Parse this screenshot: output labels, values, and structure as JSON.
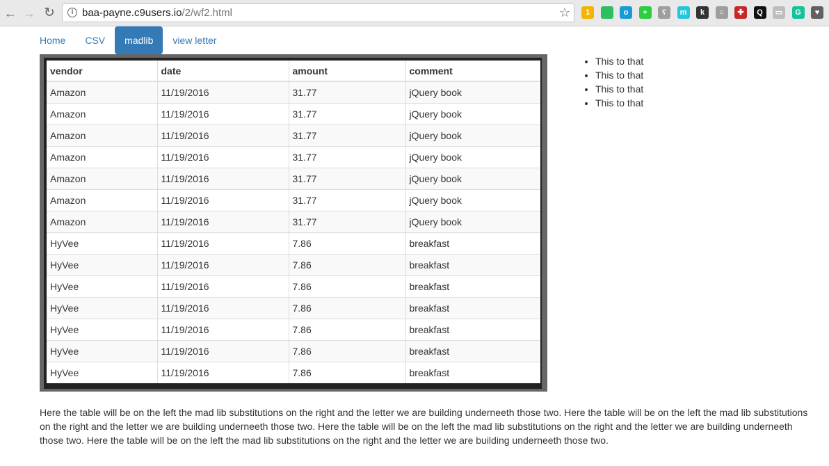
{
  "browser": {
    "url_host": "baa-payne.c9users.io",
    "url_path": "/2/wf2.html",
    "extensions": [
      {
        "name": "sticky-notes-icon",
        "color": "#f4b400",
        "glyph": "1"
      },
      {
        "name": "evernote-icon",
        "color": "#2dbe60",
        "glyph": ""
      },
      {
        "name": "circle-ext-icon",
        "color": "#1a9bd7",
        "glyph": "o"
      },
      {
        "name": "plus-ext-icon",
        "color": "#2ecc40",
        "glyph": "+"
      },
      {
        "name": "bear-ext-icon",
        "color": "#9e9e9e",
        "glyph": "ʕ"
      },
      {
        "name": "m-ext-icon",
        "color": "#26c6da",
        "glyph": "m"
      },
      {
        "name": "k-ext-icon",
        "color": "#333333",
        "glyph": "k"
      },
      {
        "name": "bulb-ext-icon",
        "color": "#9e9e9e",
        "glyph": "○"
      },
      {
        "name": "cross-ext-icon",
        "color": "#c62828",
        "glyph": "✚"
      },
      {
        "name": "search-ext-icon",
        "color": "#111111",
        "glyph": "Q"
      },
      {
        "name": "cast-ext-icon",
        "color": "#bdbdbd",
        "glyph": "▭"
      },
      {
        "name": "grammarly-icon",
        "color": "#15c39a",
        "glyph": "G"
      },
      {
        "name": "shield-ext-icon",
        "color": "#616161",
        "glyph": "♥"
      }
    ]
  },
  "nav": {
    "items": [
      {
        "label": "Home",
        "active": false
      },
      {
        "label": "CSV",
        "active": false
      },
      {
        "label": "madlib",
        "active": true
      },
      {
        "label": "view letter",
        "active": false
      }
    ]
  },
  "table": {
    "headers": [
      "vendor",
      "date",
      "amount",
      "comment"
    ],
    "rows": [
      [
        "Amazon",
        "11/19/2016",
        "31.77",
        "jQuery book"
      ],
      [
        "Amazon",
        "11/19/2016",
        "31.77",
        "jQuery book"
      ],
      [
        "Amazon",
        "11/19/2016",
        "31.77",
        "jQuery book"
      ],
      [
        "Amazon",
        "11/19/2016",
        "31.77",
        "jQuery book"
      ],
      [
        "Amazon",
        "11/19/2016",
        "31.77",
        "jQuery book"
      ],
      [
        "Amazon",
        "11/19/2016",
        "31.77",
        "jQuery book"
      ],
      [
        "Amazon",
        "11/19/2016",
        "31.77",
        "jQuery book"
      ],
      [
        "HyVee",
        "11/19/2016",
        "7.86",
        "breakfast"
      ],
      [
        "HyVee",
        "11/19/2016",
        "7.86",
        "breakfast"
      ],
      [
        "HyVee",
        "11/19/2016",
        "7.86",
        "breakfast"
      ],
      [
        "HyVee",
        "11/19/2016",
        "7.86",
        "breakfast"
      ],
      [
        "HyVee",
        "11/19/2016",
        "7.86",
        "breakfast"
      ],
      [
        "HyVee",
        "11/19/2016",
        "7.86",
        "breakfast"
      ],
      [
        "HyVee",
        "11/19/2016",
        "7.86",
        "breakfast"
      ]
    ]
  },
  "substitutions": [
    "This to that",
    "This to that",
    "This to that",
    "This to that"
  ],
  "paragraph": "Here the table will be on the left the mad lib substitutions on the right and the letter we are building underneeth those two. Here the table will be on the left the mad lib substitutions on the right and the letter we are building underneeth those two. Here the table will be on the left the mad lib substitutions on the right and the letter we are building underneeth those two. Here the table will be on the left the mad lib substitutions on the right and the letter we are building underneeth those two."
}
